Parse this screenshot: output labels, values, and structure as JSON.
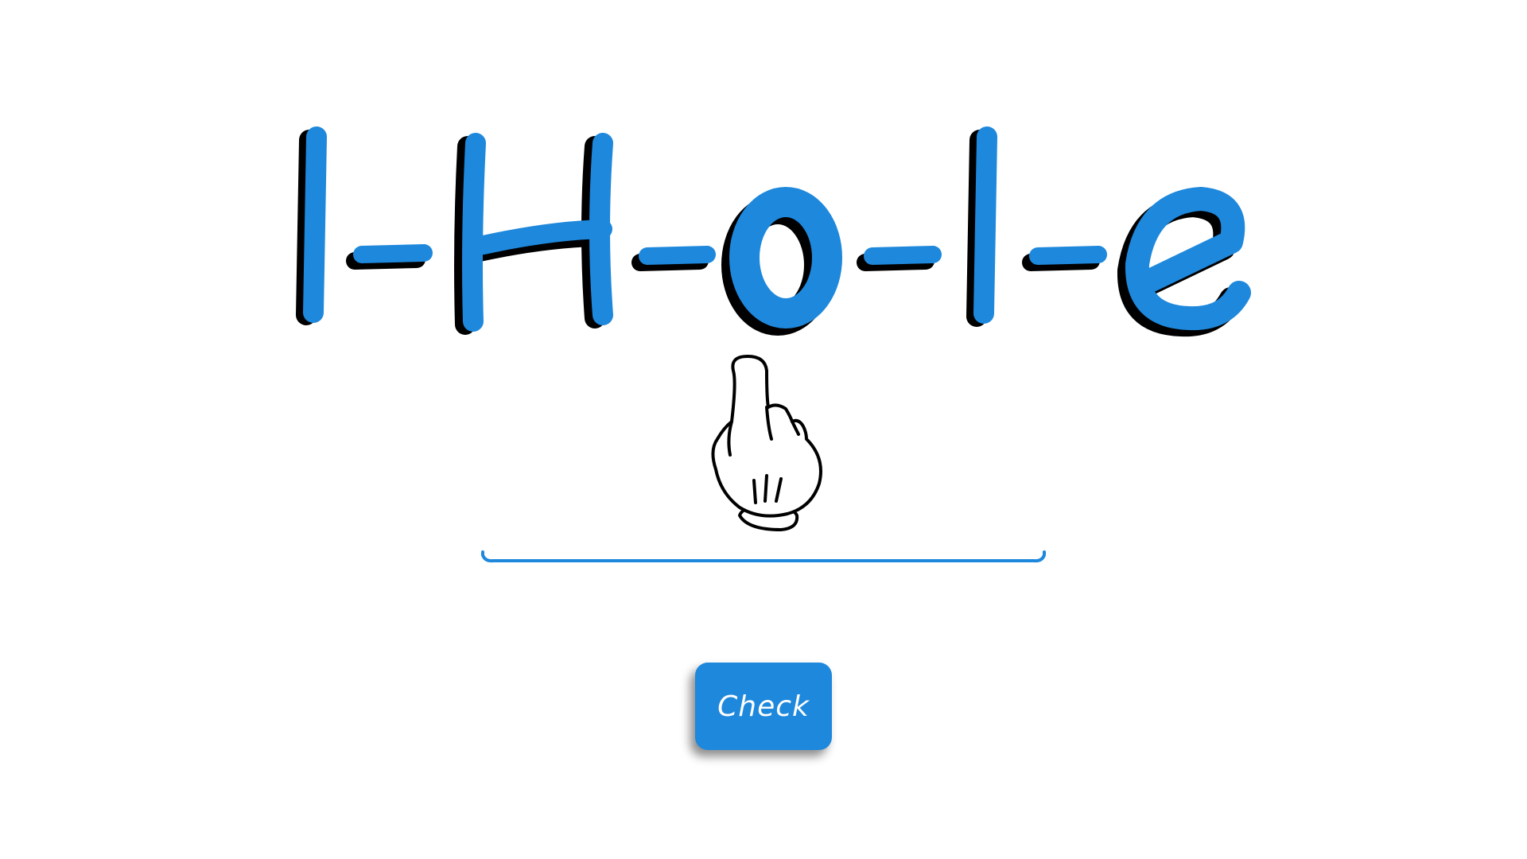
{
  "puzzle": {
    "letters": [
      "l",
      "H",
      "o",
      "l",
      "e"
    ],
    "separator": "-"
  },
  "answer": {
    "value": ""
  },
  "check_button": {
    "label": "Check"
  },
  "icons": {
    "hand": "pointing-hand-icon"
  },
  "colors": {
    "accent": "#1e88dc",
    "shadow": "#000000",
    "background": "#ffffff"
  }
}
